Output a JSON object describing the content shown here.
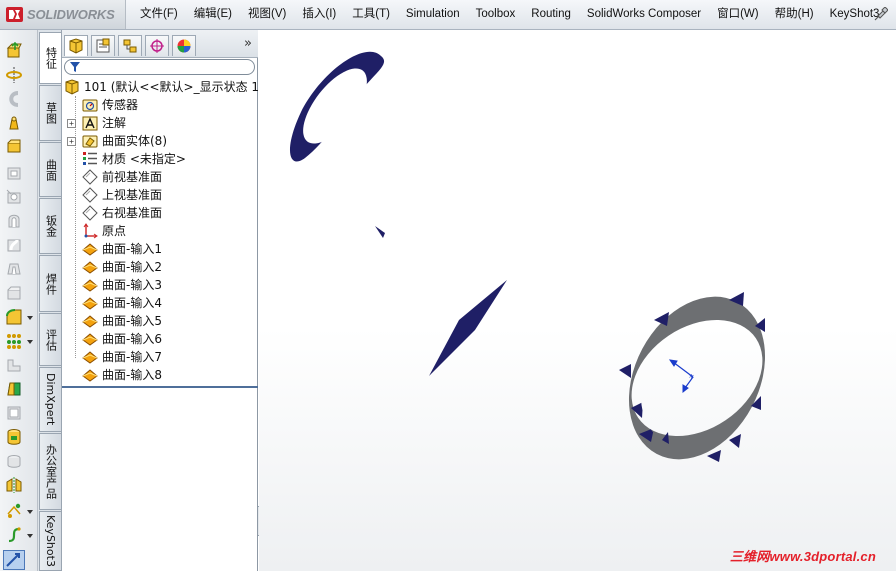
{
  "app": {
    "brand": "SOLIDWORKS"
  },
  "menubar": {
    "items": [
      "文件(F)",
      "编辑(E)",
      "视图(V)",
      "插入(I)",
      "工具(T)",
      "Simulation",
      "Toolbox",
      "Routing",
      "SolidWorks Composer",
      "窗口(W)",
      "帮助(H)",
      "KeyShot3"
    ]
  },
  "vertical_tabs": [
    "特征",
    "草图",
    "曲面",
    "钣金",
    "焊件",
    "评估",
    "DimXpert",
    "办公室产品",
    "KeyShot3"
  ],
  "feature_tree": {
    "root": {
      "label": "101  (默认<<默认>_显示状态 1",
      "icon": "part-icon"
    },
    "items": [
      {
        "label": "传感器",
        "icon": "sensor-icon"
      },
      {
        "label": "注解",
        "icon": "annotation-icon",
        "expandable": true
      },
      {
        "label": "曲面实体(8)",
        "icon": "surface-bodies-icon",
        "expandable": true
      },
      {
        "label": "材质 <未指定>",
        "icon": "material-icon"
      },
      {
        "label": "前视基准面",
        "icon": "plane-icon"
      },
      {
        "label": "上视基准面",
        "icon": "plane-icon"
      },
      {
        "label": "右视基准面",
        "icon": "plane-icon"
      },
      {
        "label": "原点",
        "icon": "origin-icon"
      },
      {
        "label": "曲面-输入1",
        "icon": "imported-surface-icon"
      },
      {
        "label": "曲面-输入2",
        "icon": "imported-surface-icon"
      },
      {
        "label": "曲面-输入3",
        "icon": "imported-surface-icon"
      },
      {
        "label": "曲面-输入4",
        "icon": "imported-surface-icon"
      },
      {
        "label": "曲面-输入5",
        "icon": "imported-surface-icon"
      },
      {
        "label": "曲面-输入6",
        "icon": "imported-surface-icon"
      },
      {
        "label": "曲面-输入7",
        "icon": "imported-surface-icon"
      },
      {
        "label": "曲面-输入8",
        "icon": "imported-surface-icon"
      }
    ]
  },
  "panel": {
    "more_glyph": "»"
  },
  "watermark": "三维网www.3dportal.cn",
  "colors": {
    "surface_navy": "#1f1f66",
    "ring_gray": "#6d6f72",
    "triad_blue": "#1a3ccc",
    "watermark_red": "#e4202a"
  }
}
